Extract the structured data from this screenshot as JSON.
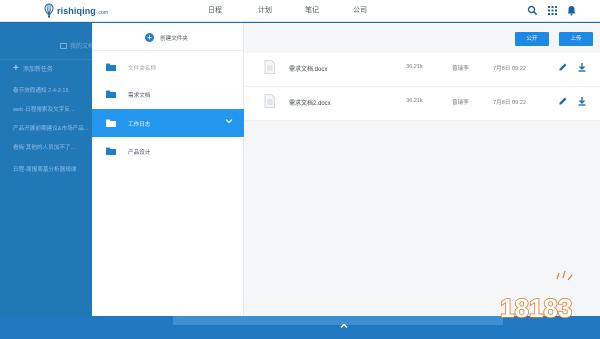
{
  "app": {
    "logo_text": "rishiqing",
    "logo_suffix": ".com",
    "nav": [
      "日程",
      "计划",
      "笔记",
      "公司"
    ],
    "icons": {
      "search": "search-icon",
      "apps": "grid-icon",
      "notify": "bell-icon"
    }
  },
  "sidebar": {
    "my_docs": "我的文档",
    "add_task": "添加新任务",
    "tasks": [
      "春节放假通知 2.4-2.15",
      "web-日程搜索及文字反...",
      "产品开展前期建议&市场产品...",
      "看板 其他的人员加不了...",
      "日程-周报周基分析器规律"
    ]
  },
  "folders": {
    "create_label": "创建文件夹",
    "items": [
      {
        "label": "文件夹名称",
        "muted": true
      },
      {
        "label": "需求文档",
        "muted": false
      },
      {
        "label": "工作日志",
        "active": true
      },
      {
        "label": "产品设计",
        "muted": false
      }
    ]
  },
  "toolbar": {
    "public_label": "公开",
    "upload_label": "上传"
  },
  "files": [
    {
      "name": "需求文档.docx",
      "size": "36.21k",
      "owner": "曾瑞李",
      "date": "7月8日  09:22"
    },
    {
      "name": "需求文档2.docx",
      "size": "36.21k",
      "owner": "曾瑞李",
      "date": "7月8日  09:22"
    }
  ],
  "colors": {
    "brand": "#1f5fa0",
    "accent": "#1e88e5",
    "sidebar": "#2078b7",
    "active_folder": "#2396ee"
  },
  "watermark": {
    "text": "18183"
  }
}
